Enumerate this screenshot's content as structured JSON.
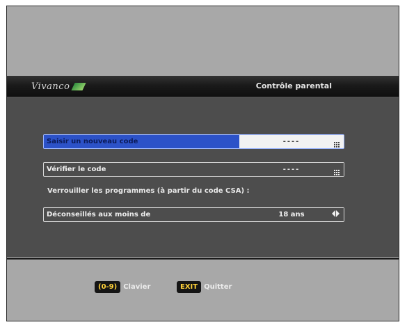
{
  "header": {
    "brand": "Vivanco",
    "title": "Contrôle parental"
  },
  "rows": {
    "new_code": {
      "label": "Saisir un nouveau code",
      "value": "----",
      "icon": "keypad-icon"
    },
    "verify_code": {
      "label": "Vérifier le code",
      "value": "----",
      "icon": "keypad-icon"
    },
    "lock_heading": "Verrouiller les programmes (à partir du code CSA) :",
    "age_limit": {
      "label": "Déconseillés aux moins de",
      "value": "18 ans",
      "icon": "left-right-arrows-icon"
    }
  },
  "footer": {
    "keypad_key": "(0-9)",
    "keypad_label": "Clavier",
    "exit_key": "EXIT",
    "exit_label": "Quitter"
  },
  "colors": {
    "selection": "#2c52c8",
    "key_text": "#ffd23a",
    "panel": "#4d4d4d",
    "frame": "#a8a8a8"
  }
}
